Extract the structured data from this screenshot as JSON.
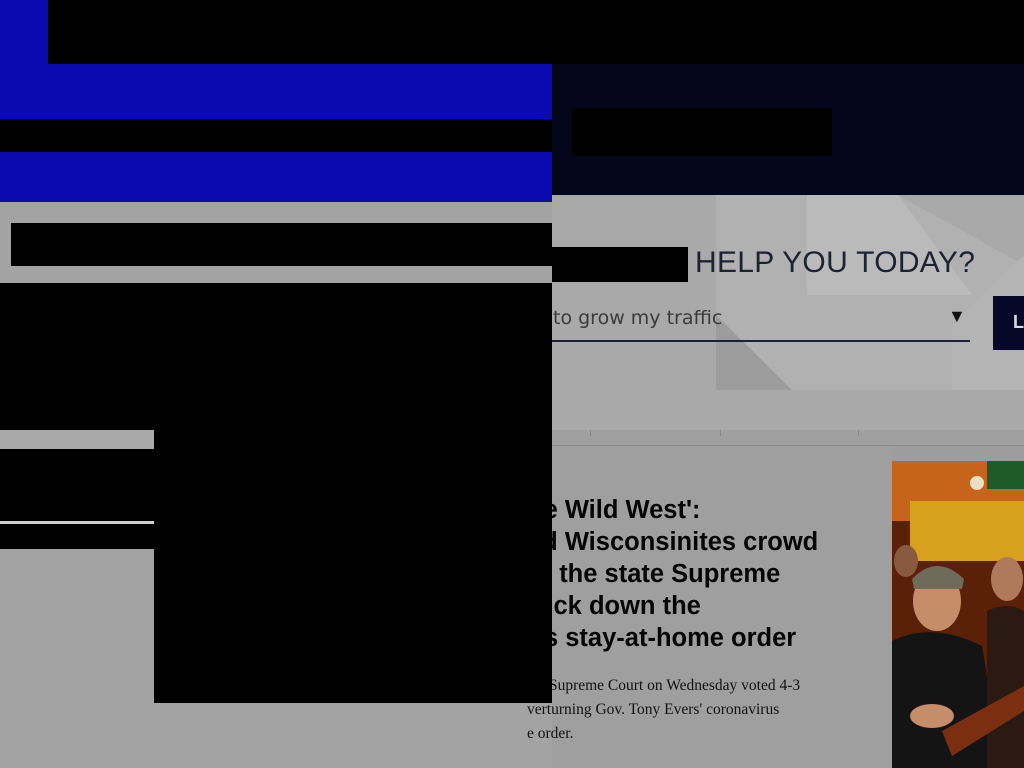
{
  "help": {
    "title": "HELP YOU TODAY?",
    "select_value": "to grow my traffic",
    "select_arrow": "▼",
    "button_label": "L"
  },
  "article": {
    "headline": "he Wild West':\ned Wisconsinites crowd\ner the state Supreme\nruck down the\nr's stay-at-home order",
    "summary": "sin Supreme Court on Wednesday voted 4-3\nverturning Gov. Tony Evers' coronavirus\ne order."
  },
  "icons": {
    "dropdown": "chevron-down-icon"
  },
  "colors": {
    "header_blue": "#0a0ab0",
    "header_dark": "#05051c",
    "navy": "#070728"
  }
}
